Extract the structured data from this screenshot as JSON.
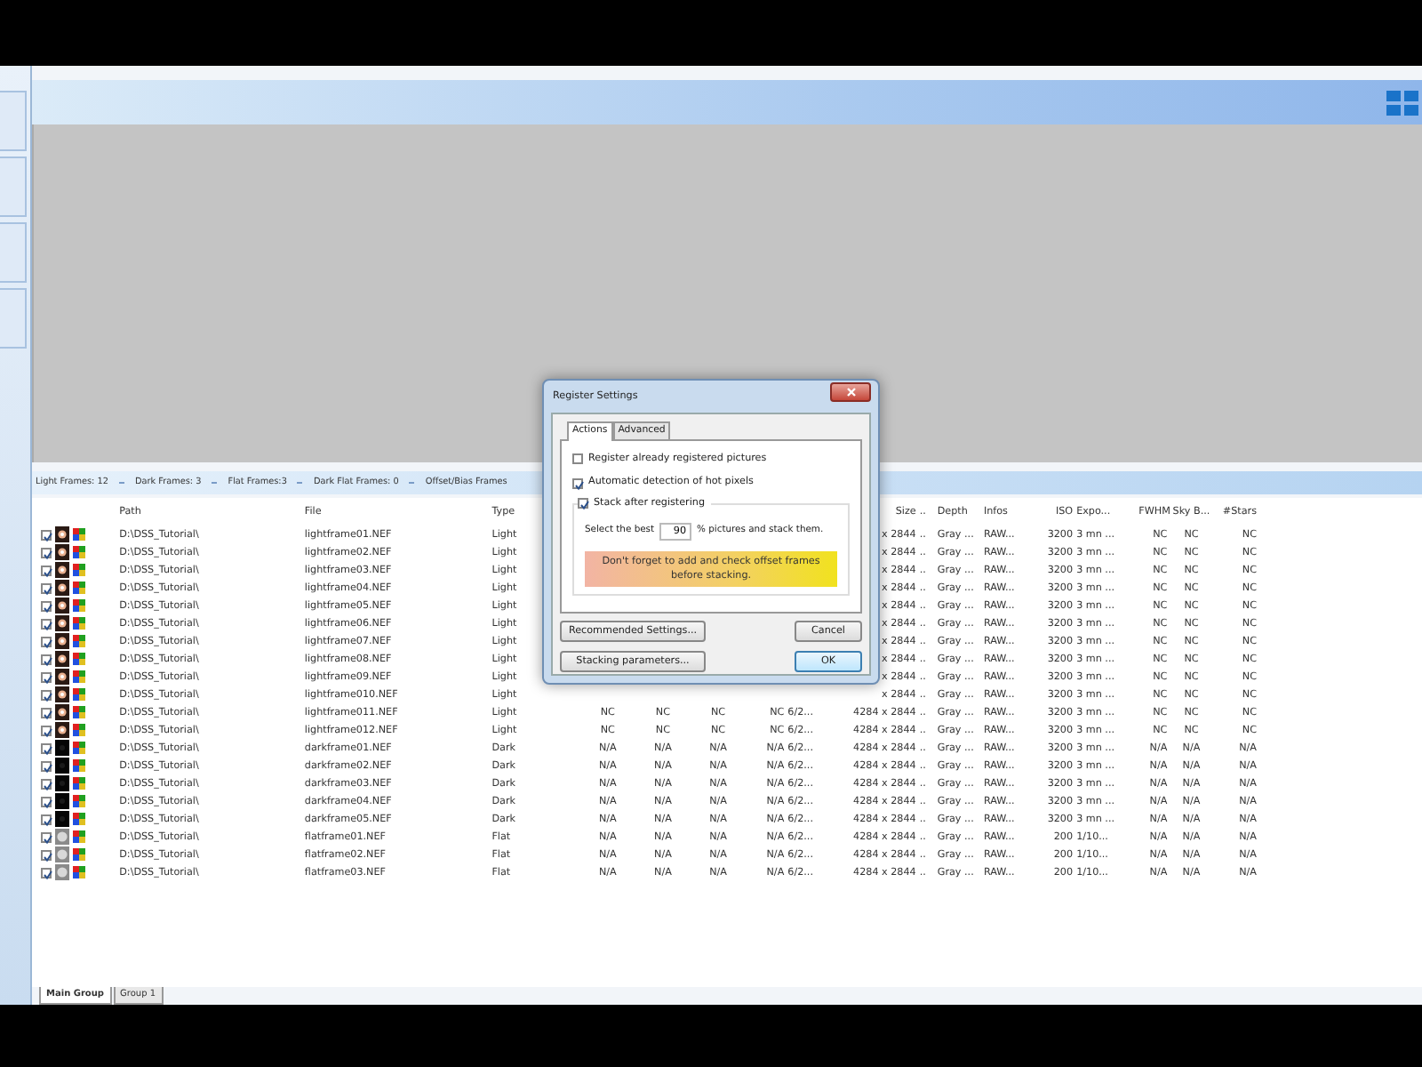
{
  "status_bar": [
    {
      "label": "Light Frames: 12"
    },
    {
      "label": "Dark Frames: 3"
    },
    {
      "label": "Flat Frames:3"
    },
    {
      "label": "Dark Flat Frames: 0"
    },
    {
      "label": "Offset/Bias Frames"
    }
  ],
  "table": {
    "columns": {
      "path": "Path",
      "file": "File",
      "type": "Type",
      "size": "Size",
      "column_10": "..",
      "depth": "Depth",
      "infos": "Infos",
      "iso": "ISO",
      "exposure": "Expo...",
      "fwhm": "FWHM",
      "sky_background": "Sky B...",
      "stars": "#Stars"
    },
    "rows": [
      {
        "checked": true,
        "kind": "light",
        "path": "D:\\DSS_Tutorial\\",
        "file": "lightframe01.NEF",
        "type": "Light",
        "size": "x 2844",
        "column_10": "..",
        "depth": "Gray ...",
        "infos": "RAW...",
        "iso": "3200",
        "exposure": "3 mn ...",
        "fwhm": "NC",
        "sky_background": "NC",
        "stars": "NC"
      },
      {
        "checked": true,
        "kind": "light",
        "path": "D:\\DSS_Tutorial\\",
        "file": "lightframe02.NEF",
        "type": "Light",
        "size": "x 2844",
        "column_10": "..",
        "depth": "Gray ...",
        "infos": "RAW...",
        "iso": "3200",
        "exposure": "3 mn ...",
        "fwhm": "NC",
        "sky_background": "NC",
        "stars": "NC"
      },
      {
        "checked": true,
        "kind": "light",
        "path": "D:\\DSS_Tutorial\\",
        "file": "lightframe03.NEF",
        "type": "Light",
        "size": "x 2844",
        "column_10": "..",
        "depth": "Gray ...",
        "infos": "RAW...",
        "iso": "3200",
        "exposure": "3 mn ...",
        "fwhm": "NC",
        "sky_background": "NC",
        "stars": "NC"
      },
      {
        "checked": true,
        "kind": "light",
        "path": "D:\\DSS_Tutorial\\",
        "file": "lightframe04.NEF",
        "type": "Light",
        "size": "x 2844",
        "column_10": "..",
        "depth": "Gray ...",
        "infos": "RAW...",
        "iso": "3200",
        "exposure": "3 mn ...",
        "fwhm": "NC",
        "sky_background": "NC",
        "stars": "NC"
      },
      {
        "checked": true,
        "kind": "light",
        "path": "D:\\DSS_Tutorial\\",
        "file": "lightframe05.NEF",
        "type": "Light",
        "size": "x 2844",
        "column_10": "..",
        "depth": "Gray ...",
        "infos": "RAW...",
        "iso": "3200",
        "exposure": "3 mn ...",
        "fwhm": "NC",
        "sky_background": "NC",
        "stars": "NC"
      },
      {
        "checked": true,
        "kind": "light",
        "path": "D:\\DSS_Tutorial\\",
        "file": "lightframe06.NEF",
        "type": "Light",
        "size": "x 2844",
        "column_10": "..",
        "depth": "Gray ...",
        "infos": "RAW...",
        "iso": "3200",
        "exposure": "3 mn ...",
        "fwhm": "NC",
        "sky_background": "NC",
        "stars": "NC"
      },
      {
        "checked": true,
        "kind": "light",
        "path": "D:\\DSS_Tutorial\\",
        "file": "lightframe07.NEF",
        "type": "Light",
        "size": "x 2844",
        "column_10": "..",
        "depth": "Gray ...",
        "infos": "RAW...",
        "iso": "3200",
        "exposure": "3 mn ...",
        "fwhm": "NC",
        "sky_background": "NC",
        "stars": "NC"
      },
      {
        "checked": true,
        "kind": "light",
        "path": "D:\\DSS_Tutorial\\",
        "file": "lightframe08.NEF",
        "type": "Light",
        "size": "x 2844",
        "column_10": "..",
        "depth": "Gray ...",
        "infos": "RAW...",
        "iso": "3200",
        "exposure": "3 mn ...",
        "fwhm": "NC",
        "sky_background": "NC",
        "stars": "NC"
      },
      {
        "checked": true,
        "kind": "light",
        "path": "D:\\DSS_Tutorial\\",
        "file": "lightframe09.NEF",
        "type": "Light",
        "size": "x 2844",
        "column_10": "..",
        "depth": "Gray ...",
        "infos": "RAW...",
        "iso": "3200",
        "exposure": "3 mn ...",
        "fwhm": "NC",
        "sky_background": "NC",
        "stars": "NC"
      },
      {
        "checked": true,
        "kind": "light",
        "path": "D:\\DSS_Tutorial\\",
        "file": "lightframe010.NEF",
        "type": "Light",
        "size": "x 2844",
        "column_10": "..",
        "depth": "Gray ...",
        "infos": "RAW...",
        "iso": "3200",
        "exposure": "3 mn ...",
        "fwhm": "NC",
        "sky_background": "NC",
        "stars": "NC"
      },
      {
        "checked": true,
        "kind": "light",
        "path": "D:\\DSS_Tutorial\\",
        "file": "lightframe011.NEF",
        "type": "Light",
        "column_4": "NC",
        "column_5": "NC",
        "column_6": "NC",
        "column_7": "NC",
        "column_8": "6/2...",
        "size": "4284 x 2844",
        "column_10": "..",
        "depth": "Gray ...",
        "infos": "RAW...",
        "iso": "3200",
        "exposure": "3 mn ...",
        "fwhm": "NC",
        "sky_background": "NC",
        "stars": "NC"
      },
      {
        "checked": true,
        "kind": "light",
        "path": "D:\\DSS_Tutorial\\",
        "file": "lightframe012.NEF",
        "type": "Light",
        "column_4": "NC",
        "column_5": "NC",
        "column_6": "NC",
        "column_7": "NC",
        "column_8": "6/2...",
        "size": "4284 x 2844",
        "column_10": "..",
        "depth": "Gray ...",
        "infos": "RAW...",
        "iso": "3200",
        "exposure": "3 mn ...",
        "fwhm": "NC",
        "sky_background": "NC",
        "stars": "NC"
      },
      {
        "checked": true,
        "kind": "dark",
        "path": "D:\\DSS_Tutorial\\",
        "file": "darkframe01.NEF",
        "type": "Dark",
        "column_4": "N/A",
        "column_5": "N/A",
        "column_6": "N/A",
        "column_7": "N/A",
        "column_8": "6/2...",
        "size": "4284 x 2844",
        "column_10": "..",
        "depth": "Gray ...",
        "infos": "RAW...",
        "iso": "3200",
        "exposure": "3 mn ...",
        "fwhm": "N/A",
        "sky_background": "N/A",
        "stars": "N/A"
      },
      {
        "checked": true,
        "kind": "dark",
        "path": "D:\\DSS_Tutorial\\",
        "file": "darkframe02.NEF",
        "type": "Dark",
        "column_4": "N/A",
        "column_5": "N/A",
        "column_6": "N/A",
        "column_7": "N/A",
        "column_8": "6/2...",
        "size": "4284 x 2844",
        "column_10": "..",
        "depth": "Gray ...",
        "infos": "RAW...",
        "iso": "3200",
        "exposure": "3 mn ...",
        "fwhm": "N/A",
        "sky_background": "N/A",
        "stars": "N/A"
      },
      {
        "checked": true,
        "kind": "dark",
        "path": "D:\\DSS_Tutorial\\",
        "file": "darkframe03.NEF",
        "type": "Dark",
        "column_4": "N/A",
        "column_5": "N/A",
        "column_6": "N/A",
        "column_7": "N/A",
        "column_8": "6/2...",
        "size": "4284 x 2844",
        "column_10": "..",
        "depth": "Gray ...",
        "infos": "RAW...",
        "iso": "3200",
        "exposure": "3 mn ...",
        "fwhm": "N/A",
        "sky_background": "N/A",
        "stars": "N/A"
      },
      {
        "checked": true,
        "kind": "dark",
        "path": "D:\\DSS_Tutorial\\",
        "file": "darkframe04.NEF",
        "type": "Dark",
        "column_4": "N/A",
        "column_5": "N/A",
        "column_6": "N/A",
        "column_7": "N/A",
        "column_8": "6/2...",
        "size": "4284 x 2844",
        "column_10": "..",
        "depth": "Gray ...",
        "infos": "RAW...",
        "iso": "3200",
        "exposure": "3 mn ...",
        "fwhm": "N/A",
        "sky_background": "N/A",
        "stars": "N/A"
      },
      {
        "checked": true,
        "kind": "dark",
        "path": "D:\\DSS_Tutorial\\",
        "file": "darkframe05.NEF",
        "type": "Dark",
        "column_4": "N/A",
        "column_5": "N/A",
        "column_6": "N/A",
        "column_7": "N/A",
        "column_8": "6/2...",
        "size": "4284 x 2844",
        "column_10": "..",
        "depth": "Gray ...",
        "infos": "RAW...",
        "iso": "3200",
        "exposure": "3 mn ...",
        "fwhm": "N/A",
        "sky_background": "N/A",
        "stars": "N/A"
      },
      {
        "checked": true,
        "kind": "flat",
        "path": "D:\\DSS_Tutorial\\",
        "file": "flatframe01.NEF",
        "type": "Flat",
        "column_4": "N/A",
        "column_5": "N/A",
        "column_6": "N/A",
        "column_7": "N/A",
        "column_8": "6/2...",
        "size": "4284 x 2844",
        "column_10": "..",
        "depth": "Gray ...",
        "infos": "RAW...",
        "iso": "200",
        "exposure": "1/10...",
        "fwhm": "N/A",
        "sky_background": "N/A",
        "stars": "N/A"
      },
      {
        "checked": true,
        "kind": "flat",
        "path": "D:\\DSS_Tutorial\\",
        "file": "flatframe02.NEF",
        "type": "Flat",
        "column_4": "N/A",
        "column_5": "N/A",
        "column_6": "N/A",
        "column_7": "N/A",
        "column_8": "6/2...",
        "size": "4284 x 2844",
        "column_10": "..",
        "depth": "Gray ...",
        "infos": "RAW...",
        "iso": "200",
        "exposure": "1/10...",
        "fwhm": "N/A",
        "sky_background": "N/A",
        "stars": "N/A"
      },
      {
        "checked": true,
        "kind": "flat",
        "path": "D:\\DSS_Tutorial\\",
        "file": "flatframe03.NEF",
        "type": "Flat",
        "column_4": "N/A",
        "column_5": "N/A",
        "column_6": "N/A",
        "column_7": "N/A",
        "column_8": "6/2...",
        "size": "4284 x 2844",
        "column_10": "..",
        "depth": "Gray ...",
        "infos": "RAW...",
        "iso": "200",
        "exposure": "1/10...",
        "fwhm": "N/A",
        "sky_background": "N/A",
        "stars": "N/A"
      }
    ]
  },
  "group_tabs": [
    {
      "label": "Main Group",
      "selected": true
    },
    {
      "label": "Group 1",
      "selected": false
    }
  ],
  "dialog": {
    "title": "Register Settings",
    "tabs": [
      {
        "label": "Actions",
        "selected": true
      },
      {
        "label": "Advanced",
        "selected": false
      }
    ],
    "options": [
      {
        "label": "Register already registered pictures",
        "checked": false
      },
      {
        "label": "Automatic detection of hot pixels",
        "checked": true
      }
    ],
    "stack_group": {
      "label": "Stack after registering",
      "checked": true,
      "prefix": "Select the best",
      "value": "90",
      "suffix": "% pictures and stack them.",
      "warning": "Don't forget to add and check offset frames before stacking."
    },
    "buttons": [
      {
        "label": "Recommended Settings...",
        "kind": "normal"
      },
      {
        "label": "Cancel",
        "kind": "normal"
      },
      {
        "label": "Stacking parameters...",
        "kind": "normal"
      },
      {
        "label": "OK",
        "kind": "default"
      }
    ]
  }
}
